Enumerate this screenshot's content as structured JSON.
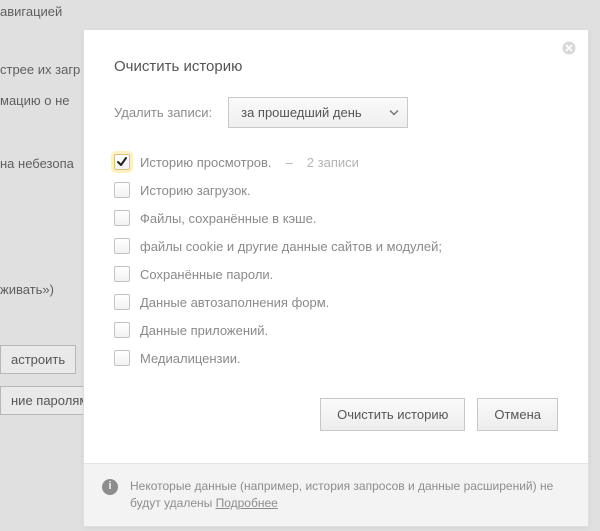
{
  "background": {
    "frag_nav": "авигацией",
    "frag_fast": "стрее их загр",
    "frag_info": "мацию о не",
    "frag_unsafe": "на небезопа",
    "frag_show": "живать»)",
    "btn_configure": "астроить",
    "frag_passwords": "ние паролям"
  },
  "dialog": {
    "title": "Очистить историю",
    "period_label": "Удалить записи:",
    "period_value": "за прошедший день",
    "items": [
      {
        "label": "Историю просмотров.",
        "count_sep": "–",
        "count": "2 записи",
        "checked": true
      },
      {
        "label": "Историю загрузок.",
        "checked": false
      },
      {
        "label": "Файлы, сохранённые в кэше.",
        "checked": false
      },
      {
        "label": "файлы cookie и другие данные сайтов и модулей;",
        "checked": false
      },
      {
        "label": "Сохранённые пароли.",
        "checked": false
      },
      {
        "label": "Данные автозаполнения форм.",
        "checked": false
      },
      {
        "label": "Данные приложений.",
        "checked": false
      },
      {
        "label": "Медиалицензии.",
        "checked": false
      }
    ],
    "btn_clear": "Очистить историю",
    "btn_cancel": "Отмена",
    "footer_text": "Некоторые данные (например, история запросов и данные расширений) не будут удалены ",
    "footer_link": "Подробнее"
  }
}
